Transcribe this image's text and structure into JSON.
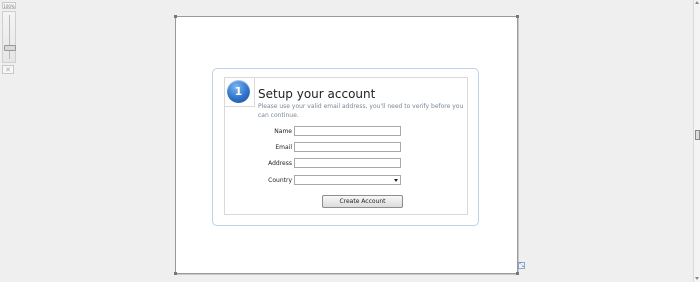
{
  "zoom": {
    "label": "100%",
    "level": 0.25
  },
  "form": {
    "step_number": "1",
    "title": "Setup your account",
    "description": "Please use your valid email address, you'll need to verify before you can continue.",
    "fields": [
      {
        "label": "Name",
        "value": ""
      },
      {
        "label": "Email",
        "value": ""
      },
      {
        "label": "Address",
        "value": ""
      },
      {
        "label": "Country",
        "value": ""
      }
    ],
    "submit_label": "Create Account"
  },
  "colors": {
    "step_badge": "#2f73c9",
    "card_border": "#bcd3ea",
    "background": "#efefef"
  },
  "icons": {
    "zoom_reset": "close-icon",
    "resize": "expand-icon",
    "select_arrow": "chevron-down-icon"
  }
}
